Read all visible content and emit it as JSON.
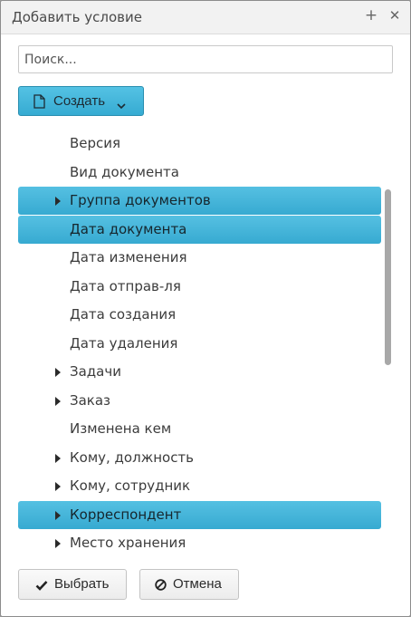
{
  "dialog": {
    "title": "Добавить условие",
    "add_icon": "plus-icon",
    "close_icon": "close-icon"
  },
  "search": {
    "placeholder": "Поиск...",
    "value": ""
  },
  "create_button": {
    "label": "Создать",
    "icon": "document-icon",
    "dropdown_icon": "chevron-down-icon"
  },
  "list": {
    "items": [
      {
        "label": "Версия",
        "expandable": false,
        "selected": false
      },
      {
        "label": "Вид документа",
        "expandable": false,
        "selected": false
      },
      {
        "label": "Группа документов",
        "expandable": true,
        "selected": true
      },
      {
        "label": "Дата документа",
        "expandable": false,
        "selected": true
      },
      {
        "label": "Дата изменения",
        "expandable": false,
        "selected": false
      },
      {
        "label": "Дата отправ-ля",
        "expandable": false,
        "selected": false
      },
      {
        "label": "Дата создания",
        "expandable": false,
        "selected": false
      },
      {
        "label": "Дата удаления",
        "expandable": false,
        "selected": false
      },
      {
        "label": "Задачи",
        "expandable": true,
        "selected": false
      },
      {
        "label": "Заказ",
        "expandable": true,
        "selected": false
      },
      {
        "label": "Изменена кем",
        "expandable": false,
        "selected": false
      },
      {
        "label": "Кому, должность",
        "expandable": true,
        "selected": false
      },
      {
        "label": "Кому, сотрудник",
        "expandable": true,
        "selected": false
      },
      {
        "label": "Корреспондент",
        "expandable": true,
        "selected": true
      },
      {
        "label": "Место хранения",
        "expandable": true,
        "selected": false
      }
    ]
  },
  "footer": {
    "ok_label": "Выбрать",
    "ok_icon": "check-icon",
    "cancel_label": "Отмена",
    "cancel_icon": "cancel-icon"
  },
  "colors": {
    "accent": "#3fb3da",
    "accent_border": "#2a8fb0"
  }
}
